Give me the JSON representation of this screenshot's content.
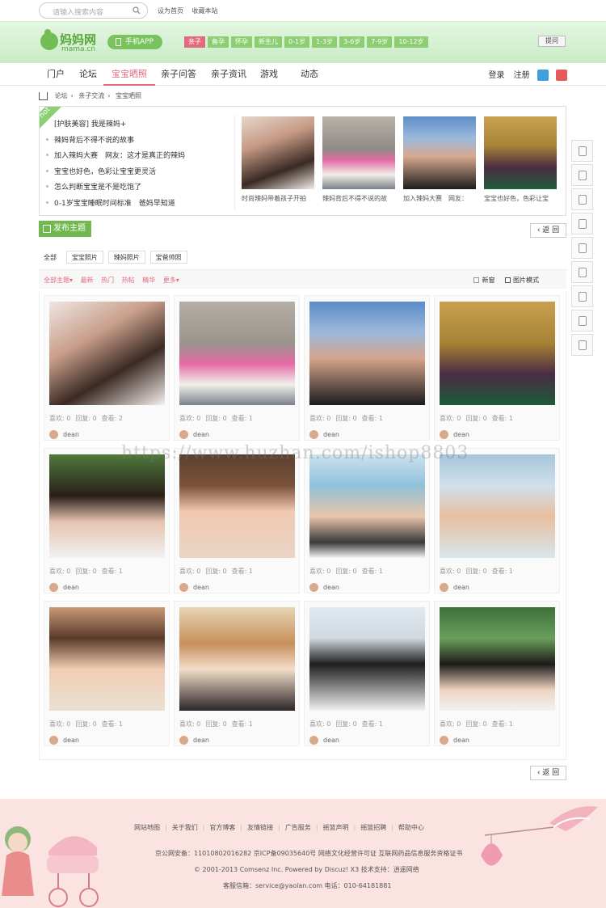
{
  "search": {
    "placeholder": "请输入搜索内容"
  },
  "toplinks": [
    "设为首页",
    "收藏本站"
  ],
  "logo": {
    "name": "妈妈网",
    "domain": "mama.cn"
  },
  "app_button": "手机APP",
  "age_tags": [
    "亲子",
    "备孕",
    "怀孕",
    "新生儿",
    "0-1岁",
    "1-3岁",
    "3-6岁",
    "7-9岁",
    "10-12岁"
  ],
  "header_button": "提问",
  "nav": {
    "items": [
      "门户",
      "论坛",
      "宝宝晒照",
      "亲子问答",
      "亲子资讯",
      "游戏",
      "动态"
    ],
    "active_index": 2,
    "login": "登录",
    "register": "注册"
  },
  "breadcrumb": [
    "论坛",
    "亲子交流",
    "宝宝晒照"
  ],
  "hot": {
    "ribbon": "hot",
    "items": [
      "[护肤美容] 我是辣妈+",
      "辣妈背后不得不说的故事",
      "加入辣妈大赛　网友：这才是真正的辣妈",
      "宝宝也好色，色彩让宝宝更灵活",
      "怎么判断宝宝是不是吃饱了",
      "0-1岁宝宝睡眠时间标准　爸妈早知道"
    ],
    "pictures": [
      {
        "caption": "时尚辣妈带着孩子开拍"
      },
      {
        "caption": "辣妈背后不得不说的故"
      },
      {
        "caption": "加入辣妈大赛　网友："
      },
      {
        "caption": "宝宝也好色，色彩让宝"
      }
    ]
  },
  "post_button": "发布主题",
  "back_label": "返 回",
  "type_tabs": [
    "全部",
    "宝宝照片",
    "辣妈照片",
    "宝爸帅照"
  ],
  "filter": {
    "left": [
      "全部主题▾",
      "最新",
      "热门",
      "热帖",
      "精华",
      "更多▾"
    ],
    "new_window": "新窗",
    "picture_mode": "图片模式"
  },
  "stat_labels": {
    "likes": "喜欢:",
    "replies": "回复:",
    "views": "查看:"
  },
  "cards": [
    {
      "likes": 0,
      "replies": 0,
      "views": 2,
      "user": "dean"
    },
    {
      "likes": 0,
      "replies": 0,
      "views": 1,
      "user": "dean"
    },
    {
      "likes": 0,
      "replies": 0,
      "views": 1,
      "user": "dean"
    },
    {
      "likes": 0,
      "replies": 0,
      "views": 1,
      "user": "dean"
    },
    {
      "likes": 0,
      "replies": 0,
      "views": 1,
      "user": "dean"
    },
    {
      "likes": 0,
      "replies": 0,
      "views": 1,
      "user": "dean"
    },
    {
      "likes": 0,
      "replies": 0,
      "views": 1,
      "user": "dean"
    },
    {
      "likes": 0,
      "replies": 0,
      "views": 1,
      "user": "dean"
    },
    {
      "likes": 0,
      "replies": 0,
      "views": 1,
      "user": "dean"
    },
    {
      "likes": 0,
      "replies": 0,
      "views": 1,
      "user": "dean"
    },
    {
      "likes": 0,
      "replies": 0,
      "views": 1,
      "user": "dean"
    },
    {
      "likes": 0,
      "replies": 0,
      "views": 1,
      "user": "dean"
    }
  ],
  "side_tools": [
    "document-icon",
    "list-icon",
    "calendar-icon",
    "qq-icon",
    "grid-icon",
    "share-icon",
    "wechat-icon",
    "qrcode-icon",
    "user-icon"
  ],
  "watermark": "https://www.huzhan.com/ishop8803",
  "footer": {
    "links": [
      "网站地图",
      "关于我们",
      "官方博客",
      "友情链接",
      "广告服务",
      "摇篮声明",
      "摇篮招聘",
      "帮助中心"
    ],
    "license": "京公网安备：11010802016282 京ICP备09035640号 网络文化经营许可证 互联网药品信息服务资格证书",
    "copyright": "© 2001-2013 Comsenz Inc.  Powered by Discuz! X3  技术支持：逍遥网络",
    "contact": "客服信箱：service@yaolan.com 电话：010-64181881"
  }
}
